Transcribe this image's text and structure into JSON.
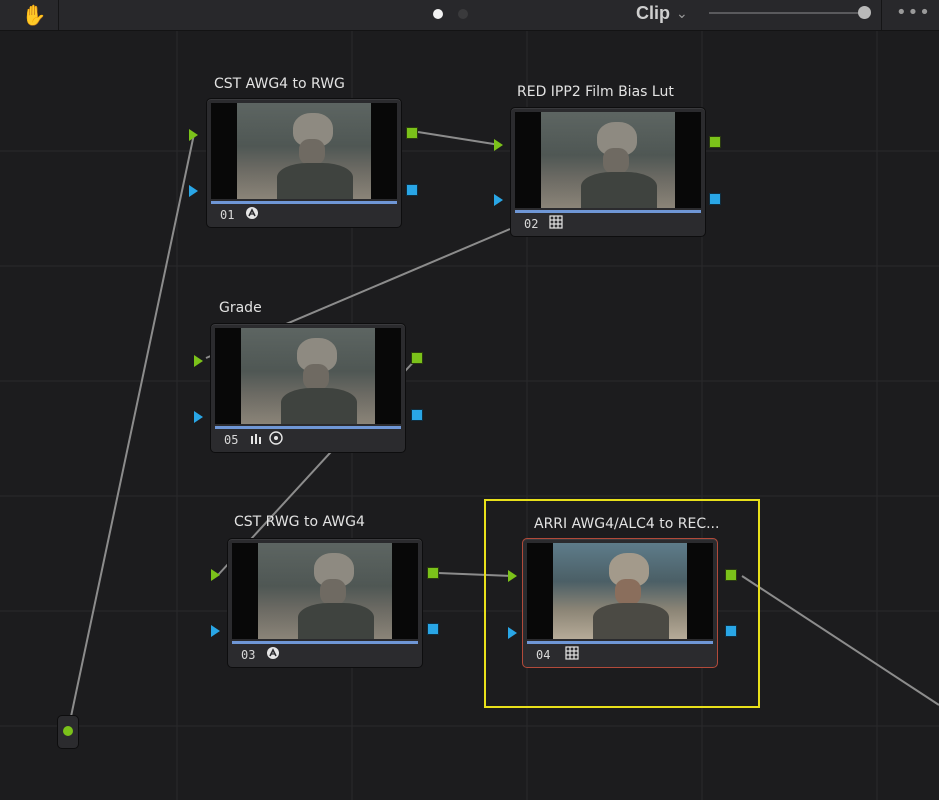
{
  "toolbar": {
    "hand_icon": "hand-tool-icon",
    "pages": [
      {
        "state": "active",
        "color": "#f2f2f2"
      },
      {
        "state": "inactive",
        "color": "#3a3a3c"
      }
    ],
    "mode_label": "Clip",
    "zoom_level": 0.95,
    "more_icon": "more-options-icon"
  },
  "nodes": [
    {
      "id": "n01",
      "title": "CST AWG4 to RWG",
      "number": "01",
      "tool_icon": "color-space-transform-icon",
      "selected": false
    },
    {
      "id": "n02",
      "title": "RED IPP2 Film Bias Lut",
      "number": "02",
      "tool_icon": "lut-grid-icon",
      "selected": false
    },
    {
      "id": "n05",
      "title": "Grade",
      "number": "05",
      "tool_icon": "curves-bars-icon",
      "tool_icon_2": "target-icon",
      "selected": false
    },
    {
      "id": "n03",
      "title": "CST RWG  to AWG4",
      "number": "03",
      "tool_icon": "color-space-transform-icon",
      "selected": false
    },
    {
      "id": "n04",
      "title": "ARRI AWG4/ALC4 to REC...",
      "number": "04",
      "tool_icon": "lut-grid-icon",
      "selected": true
    }
  ],
  "colors": {
    "rgb_port": "#7bc21a",
    "alpha_port": "#29a6e6",
    "highlight": "#e8e01a",
    "selected_border": "#b24a3a",
    "wire": "#8c8c8c"
  }
}
